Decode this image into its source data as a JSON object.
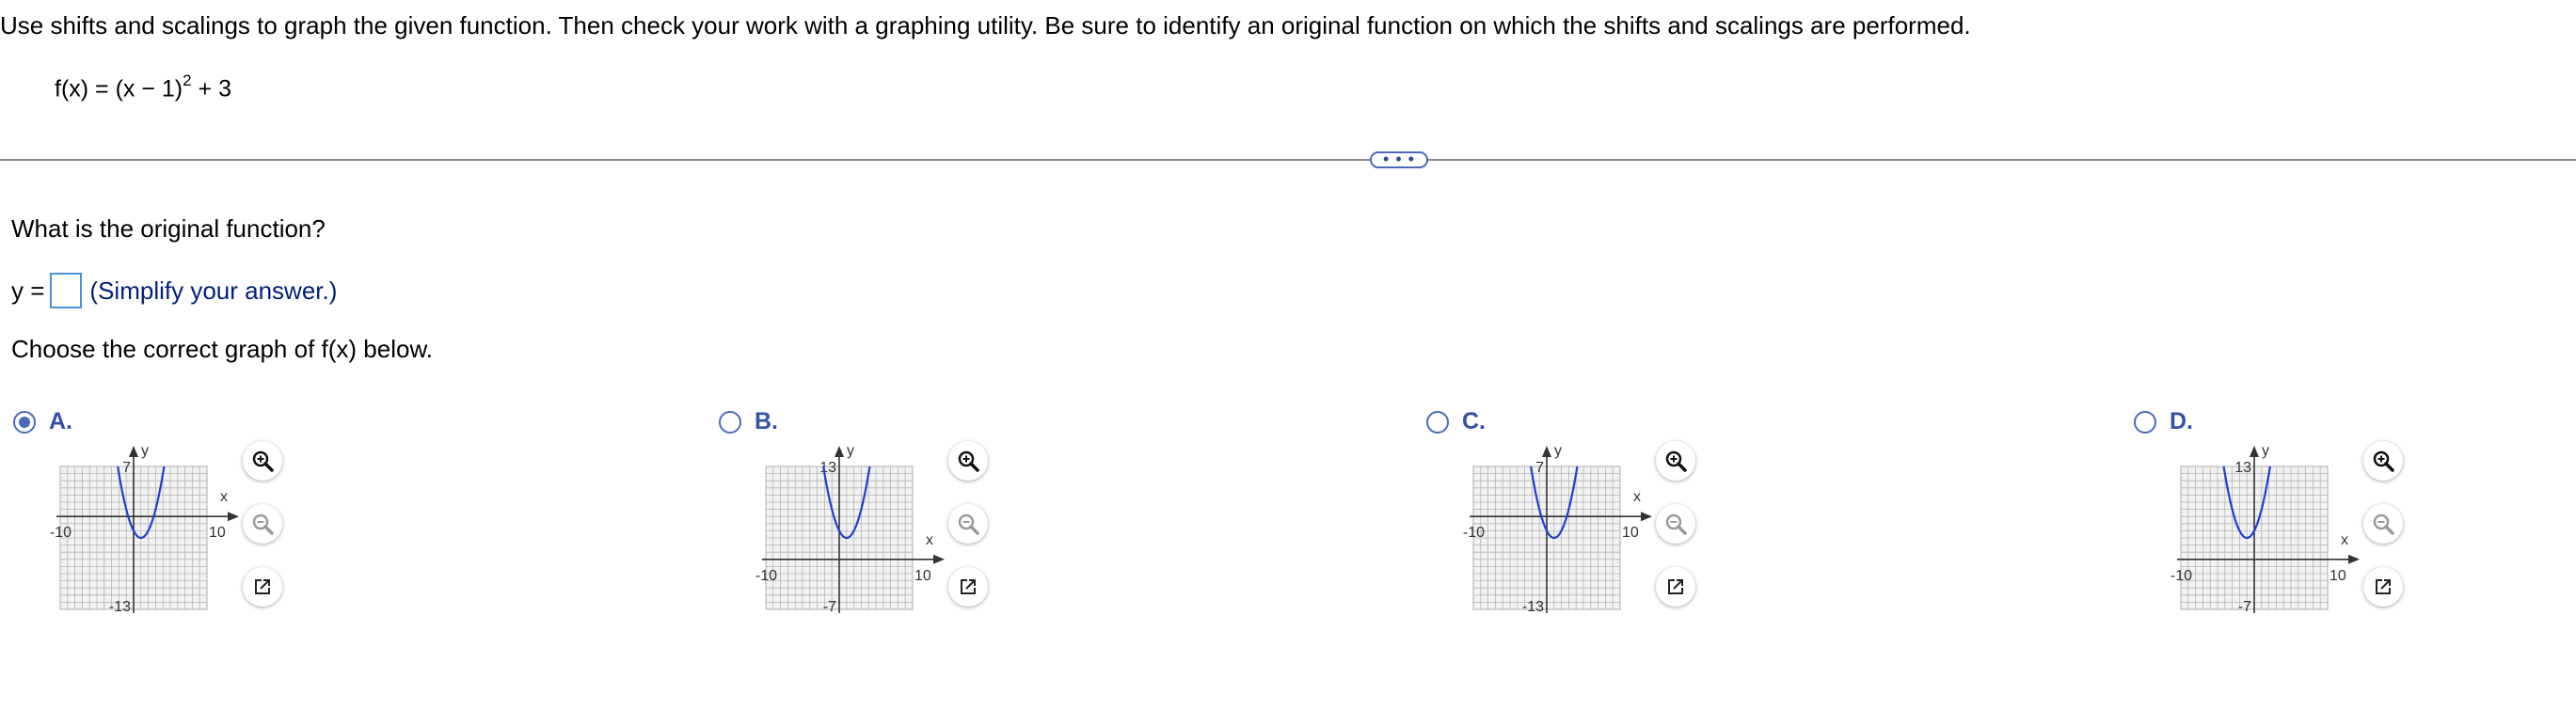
{
  "instructions": "Use shifts and scalings to graph the given function. Then check your work with a graphing utility. Be sure to identify an original function on which the shifts and scalings are performed.",
  "function": {
    "lhs": "f(x) = (x − 1)",
    "exponent": "2",
    "rhs": " + 3"
  },
  "more_button": "• • •",
  "question": "What is the original function?",
  "answer": {
    "prefix": "y =",
    "value": "",
    "hint": "(Simplify your answer.)"
  },
  "choose_text": "Choose the correct graph of f(x) below.",
  "options": [
    {
      "label": "A.",
      "selected": true,
      "ymax": "7",
      "ymin": "-13",
      "xmin": "-10",
      "xmax": "10",
      "x_axis_label": "x",
      "y_axis_label": "y",
      "vertex": [
        1,
        -3
      ]
    },
    {
      "label": "B.",
      "selected": false,
      "ymax": "13",
      "ymin": "-7",
      "xmin": "-10",
      "xmax": "10",
      "x_axis_label": "x",
      "y_axis_label": "y",
      "vertex": [
        1,
        3
      ]
    },
    {
      "label": "C.",
      "selected": false,
      "ymax": "7",
      "ymin": "-13",
      "xmin": "-10",
      "xmax": "10",
      "x_axis_label": "x",
      "y_axis_label": "y",
      "vertex": [
        1,
        -3
      ]
    },
    {
      "label": "D.",
      "selected": false,
      "ymax": "13",
      "ymin": "-7",
      "xmin": "-10",
      "xmax": "10",
      "x_axis_label": "x",
      "y_axis_label": "y",
      "vertex": [
        -1,
        3
      ]
    }
  ],
  "tool_icons": [
    "zoom-in-icon",
    "zoom-out-icon",
    "open-in-new-window-icon"
  ],
  "colors": {
    "curve": "#1f3fd1",
    "accent": "#4a6ab8",
    "input_border": "#4a90d9",
    "hint": "#001f7a"
  }
}
